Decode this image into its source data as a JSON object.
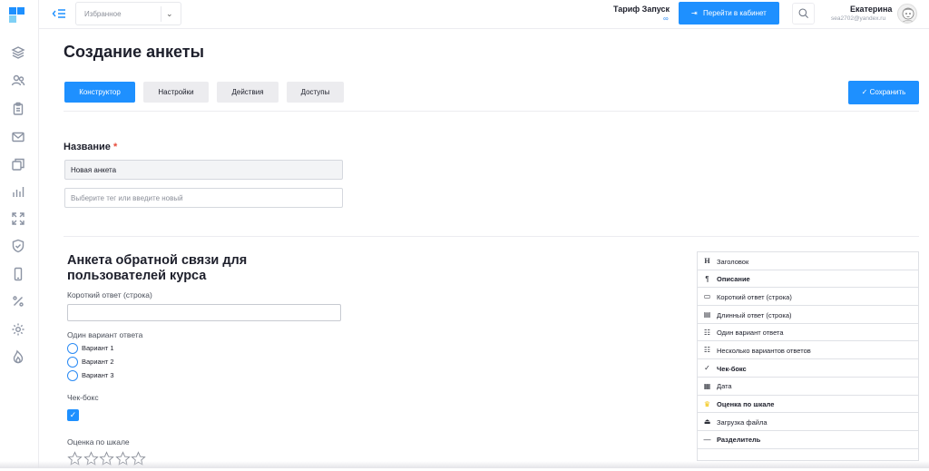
{
  "topbar": {
    "favorites_label": "Избранное",
    "tariff": "Тариф Запуск",
    "tariff_sub": "∞",
    "cabinet_button": "Перейти в кабинет",
    "user_name": "Екатерина",
    "user_email": "sea2702@yandex.ru"
  },
  "page": {
    "title": "Создание анкеты",
    "tabs": [
      {
        "label": "Конструктор",
        "active": true
      },
      {
        "label": "Настройки",
        "active": false
      },
      {
        "label": "Действия",
        "active": false
      },
      {
        "label": "Доступы",
        "active": false
      }
    ],
    "save_button": "✓ Сохранить"
  },
  "settings": {
    "name_label": "Название",
    "required_mark": "*",
    "name_value": "Новая анкета",
    "tag_placeholder": "Выберите тег или введите новый"
  },
  "form": {
    "title": "Анкета обратной связи для пользователей курса",
    "short_answer_label": "Короткий ответ (строка)",
    "single_choice_label": "Один вариант ответа",
    "options": [
      "Вариант 1",
      "Вариант 2",
      "Вариант 3"
    ],
    "checkbox_label": "Чек-бокс",
    "checkbox_checked": true,
    "rating_label": "Оценка по шкале",
    "rating_stars": 5
  },
  "palette": {
    "items": [
      {
        "label": "Заголовок",
        "icon": "heading-icon",
        "glyph": "H",
        "bold": false
      },
      {
        "label": "Описание",
        "icon": "paragraph-icon",
        "glyph": "¶",
        "bold": true
      },
      {
        "label": "Короткий ответ (строка)",
        "icon": "short-answer-icon",
        "glyph": "▭",
        "bold": false
      },
      {
        "label": "Длинный ответ (строка)",
        "icon": "long-answer-icon",
        "glyph": "▤",
        "bold": false
      },
      {
        "label": "Один вариант ответа",
        "icon": "single-choice-icon",
        "glyph": "☷",
        "bold": false
      },
      {
        "label": "Несколько вариантов ответов",
        "icon": "multi-choice-icon",
        "glyph": "☷",
        "bold": false
      },
      {
        "label": "Чек-бокс",
        "icon": "check-icon",
        "glyph": "✓",
        "bold": true
      },
      {
        "label": "Дата",
        "icon": "calendar-icon",
        "glyph": "▦",
        "bold": false
      },
      {
        "label": "Оценка по шкале",
        "icon": "rating-icon",
        "glyph": "♛",
        "bold": true
      },
      {
        "label": "Загрузка файла",
        "icon": "upload-icon",
        "glyph": "⏏",
        "bold": false
      },
      {
        "label": "Разделитель",
        "icon": "divider-icon",
        "glyph": "—",
        "bold": true
      }
    ]
  },
  "colors": {
    "accent": "#1e90ff",
    "required": "#e74c3c",
    "logo_light": "#7fd0f5",
    "logo_dark": "#1e90ff"
  }
}
